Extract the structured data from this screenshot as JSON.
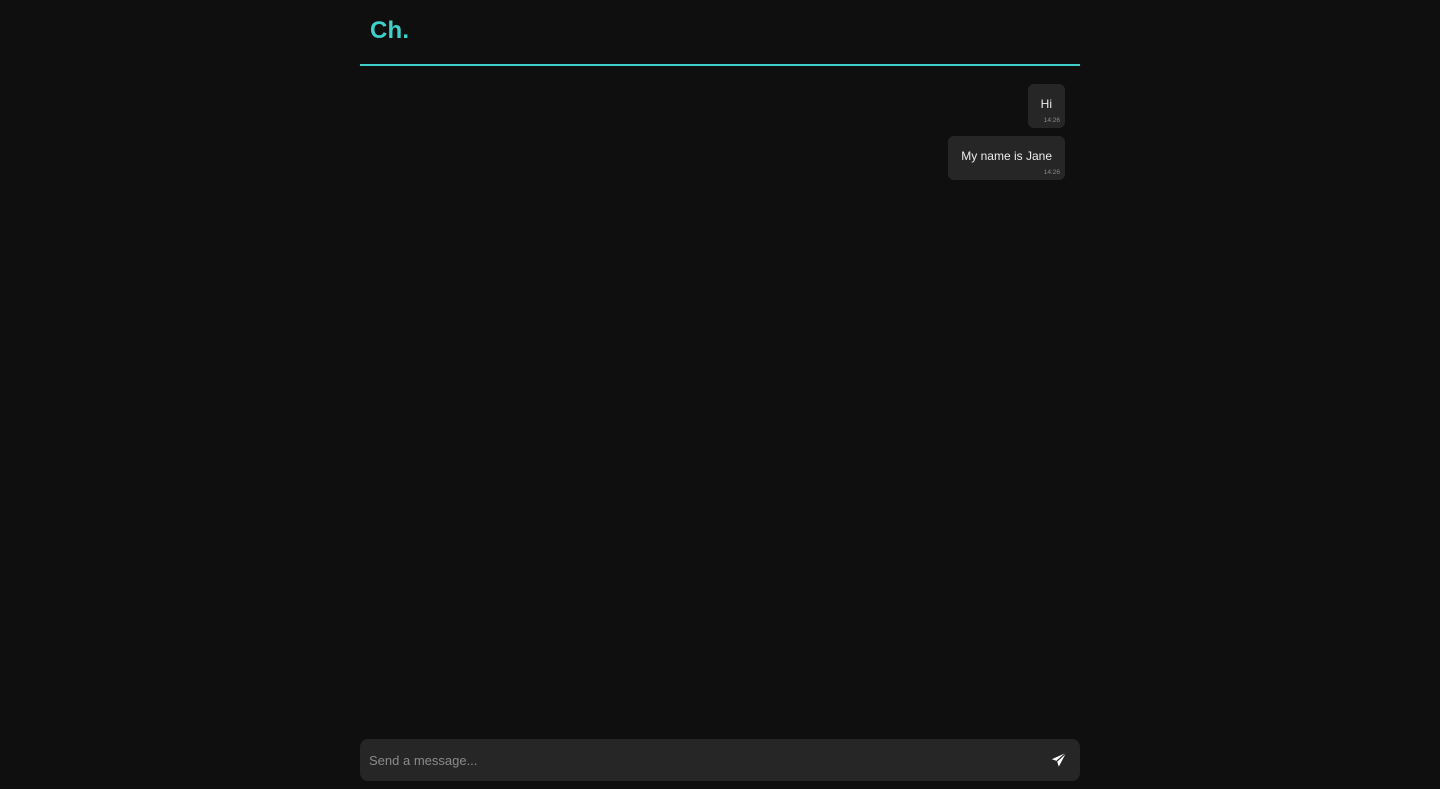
{
  "app": {
    "logo": "Ch.",
    "accent_color": "#3fd0c9"
  },
  "messages": [
    {
      "text": "Hi",
      "time": "14:26",
      "sender": "self"
    },
    {
      "text": "My name is Jane",
      "time": "14:26",
      "sender": "self"
    }
  ],
  "composer": {
    "placeholder": "Send a message...",
    "value": "",
    "send_icon": "paper-plane-icon"
  }
}
